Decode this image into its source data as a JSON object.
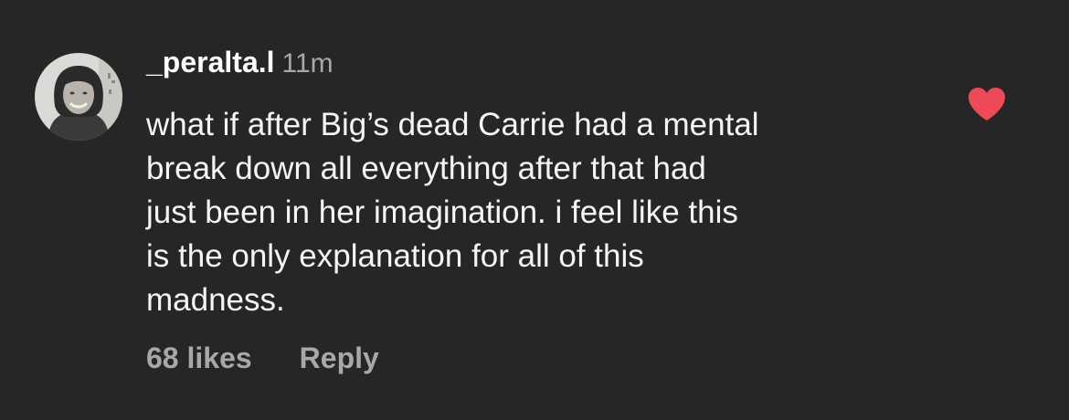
{
  "comment": {
    "username": "_peralta.l",
    "timestamp": "11m",
    "text": "what if after Big’s dead Carrie had a mental\nbreak down all everything after that had\njust been in her imagination. i feel like this\nis the only explanation for all of this\nmadness.",
    "likes_label": "68 likes",
    "reply_label": "Reply",
    "liked": true,
    "avatar_icon": "profile-photo",
    "like_icon": "heart-icon"
  },
  "colors": {
    "background": "#262626",
    "text": "#f5f5f5",
    "secondary_text": "#a8a8a8",
    "heart": "#ed4956"
  }
}
